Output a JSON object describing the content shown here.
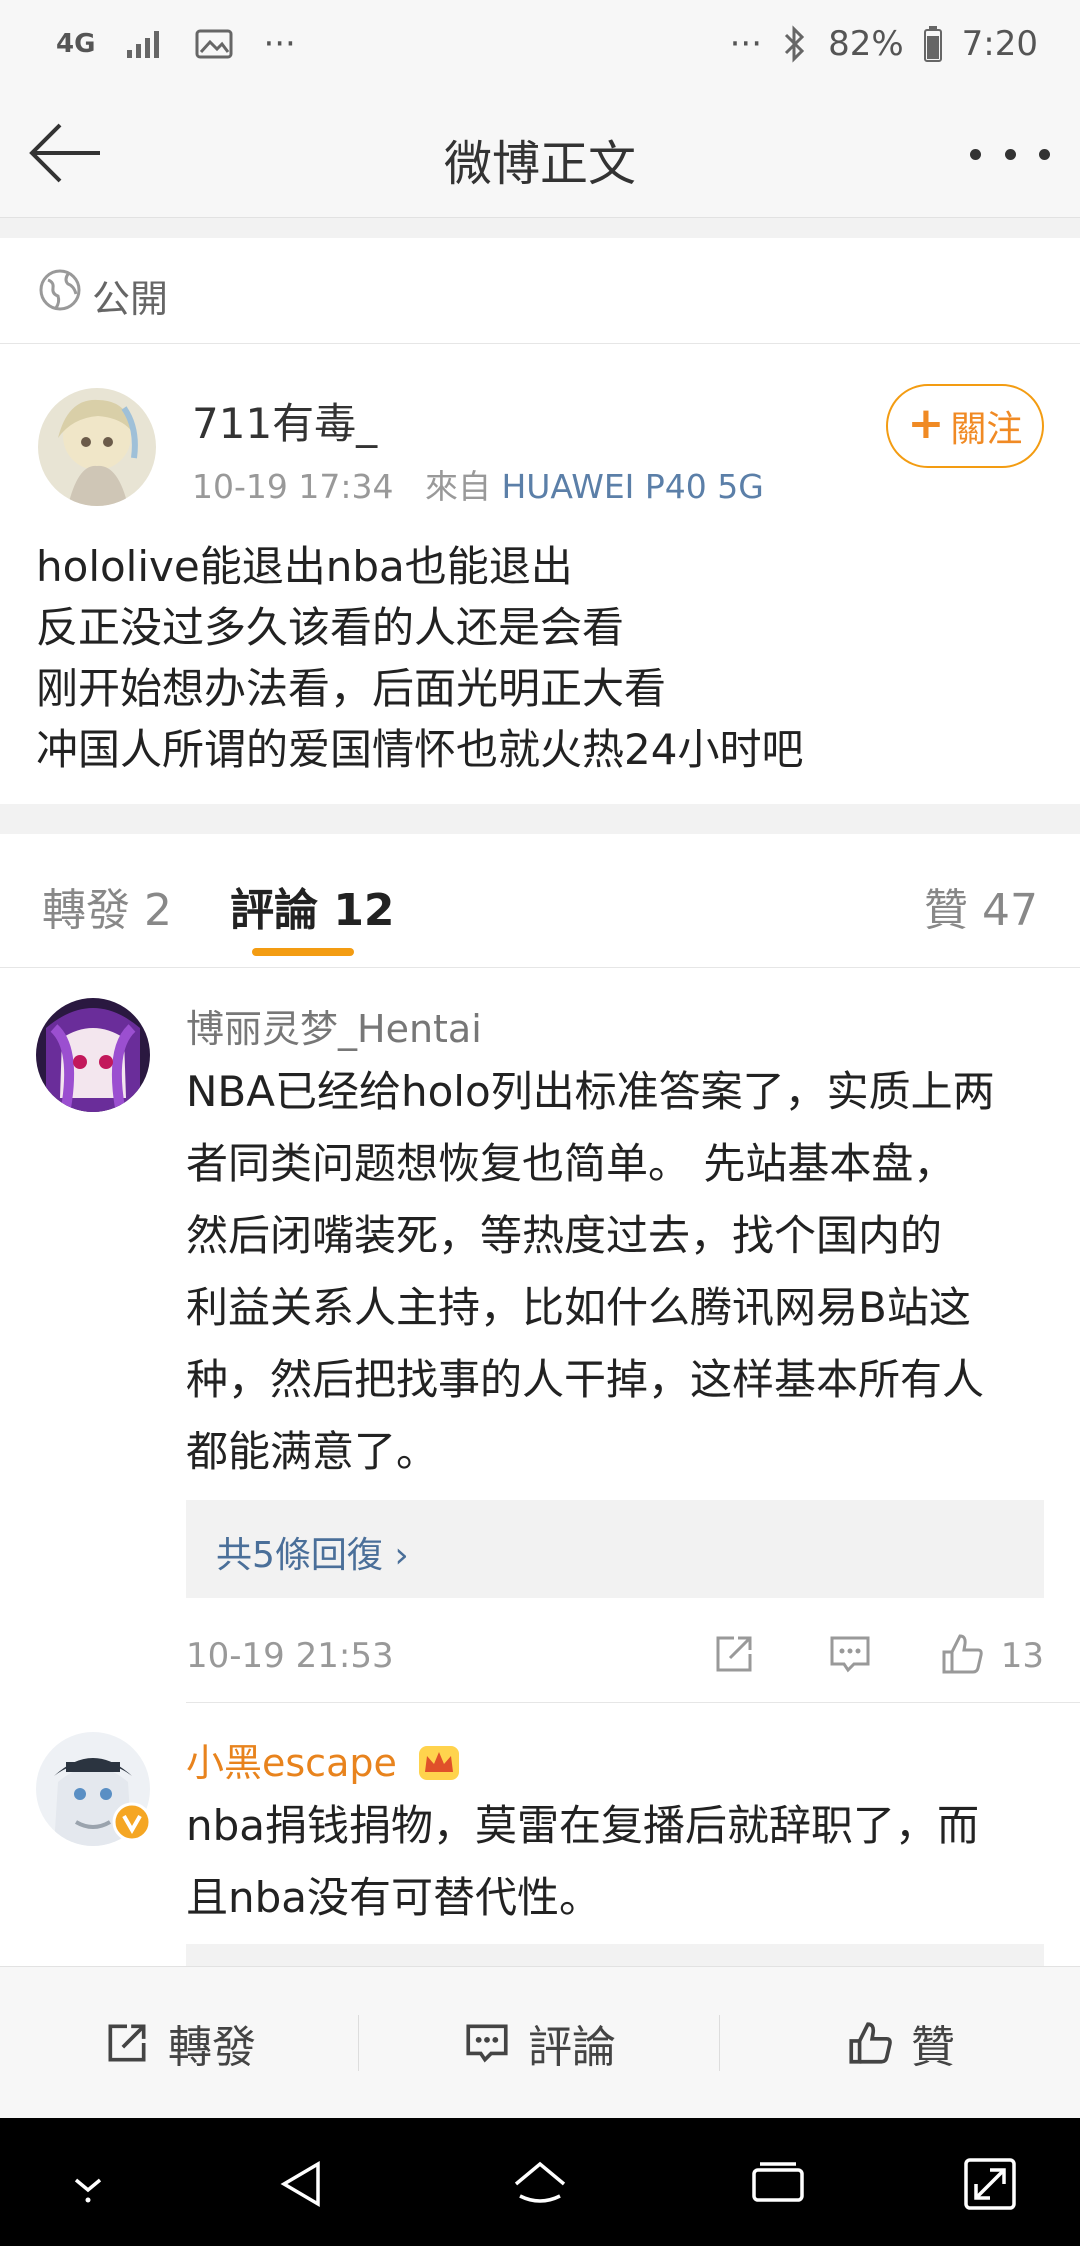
{
  "status_bar": {
    "network": "4G",
    "more_left": "···",
    "more_right": "···",
    "battery": "82%",
    "time": "7:20"
  },
  "nav": {
    "title": "微博正文"
  },
  "visibility": {
    "label": "公開"
  },
  "post": {
    "username": "711有毒_",
    "time": "10-19 17:34",
    "source_prefix": "來自",
    "device": "HUAWEI P40 5G",
    "follow_label": "關注",
    "lines": [
      "hololive能退出nba也能退出",
      "反正没过多久该看的人还是会看",
      "刚开始想办法看，后面光明正大看",
      "冲国人所谓的爱国情怀也就火热24小时吧"
    ]
  },
  "tabs": {
    "repost": "轉發 2",
    "comments": "評論 12",
    "likes": "贊 47"
  },
  "comments": [
    {
      "name": "博丽灵梦_Hentai",
      "lines": [
        "NBA已经给holo列出标准答案了，实质上两",
        "者同类问题想恢复也简单。 先站基本盘，",
        "然后闭嘴装死，等热度过去，找个国内的",
        "利益关系人主持，比如什么腾讯网易B站这",
        "种，然后把找事的人干掉，这样基本所有人",
        "都能满意了。"
      ],
      "replies": "共5條回復 ›",
      "time": "10-19 21:53",
      "likes": "13"
    },
    {
      "name": "小黑escape",
      "lines": [
        "nba捐钱捐物，莫雷在复播后就辞职了，而",
        "且nba没有可替代性。"
      ]
    }
  ],
  "bottom_bar": {
    "repost": "轉發",
    "comment": "評論",
    "like": "贊"
  },
  "colors": {
    "accent_orange": "#f39c12",
    "link_blue": "#4a6f99",
    "device_blue": "#5b7fa8"
  }
}
